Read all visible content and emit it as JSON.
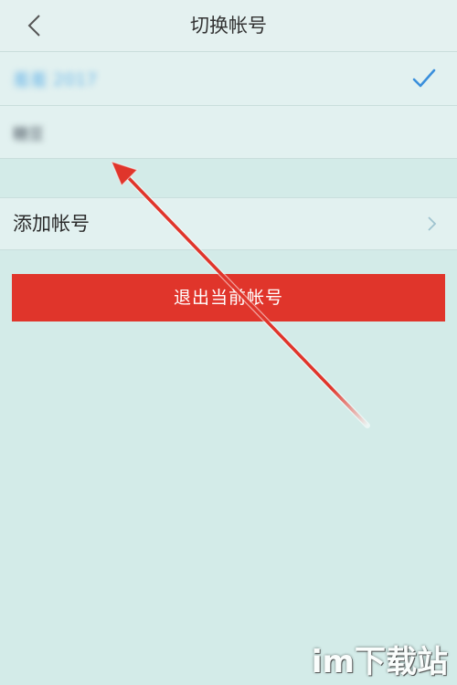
{
  "header": {
    "title": "切换帐号",
    "back_icon": "chevron-left-icon"
  },
  "accounts": [
    {
      "label": "羞羞 2017",
      "selected": true,
      "selected_color": "#3a8fdc"
    },
    {
      "label": "糖豆",
      "selected": false
    }
  ],
  "add_account": {
    "label": "添加帐号",
    "chevron_icon": "chevron-right-icon"
  },
  "logout": {
    "label": "退出当前帐号",
    "color": "#e0352b"
  },
  "annotation": {
    "arrow_icon": "red-arrow-icon",
    "color": "#e0352b"
  },
  "watermark": {
    "text": "im下载站"
  }
}
